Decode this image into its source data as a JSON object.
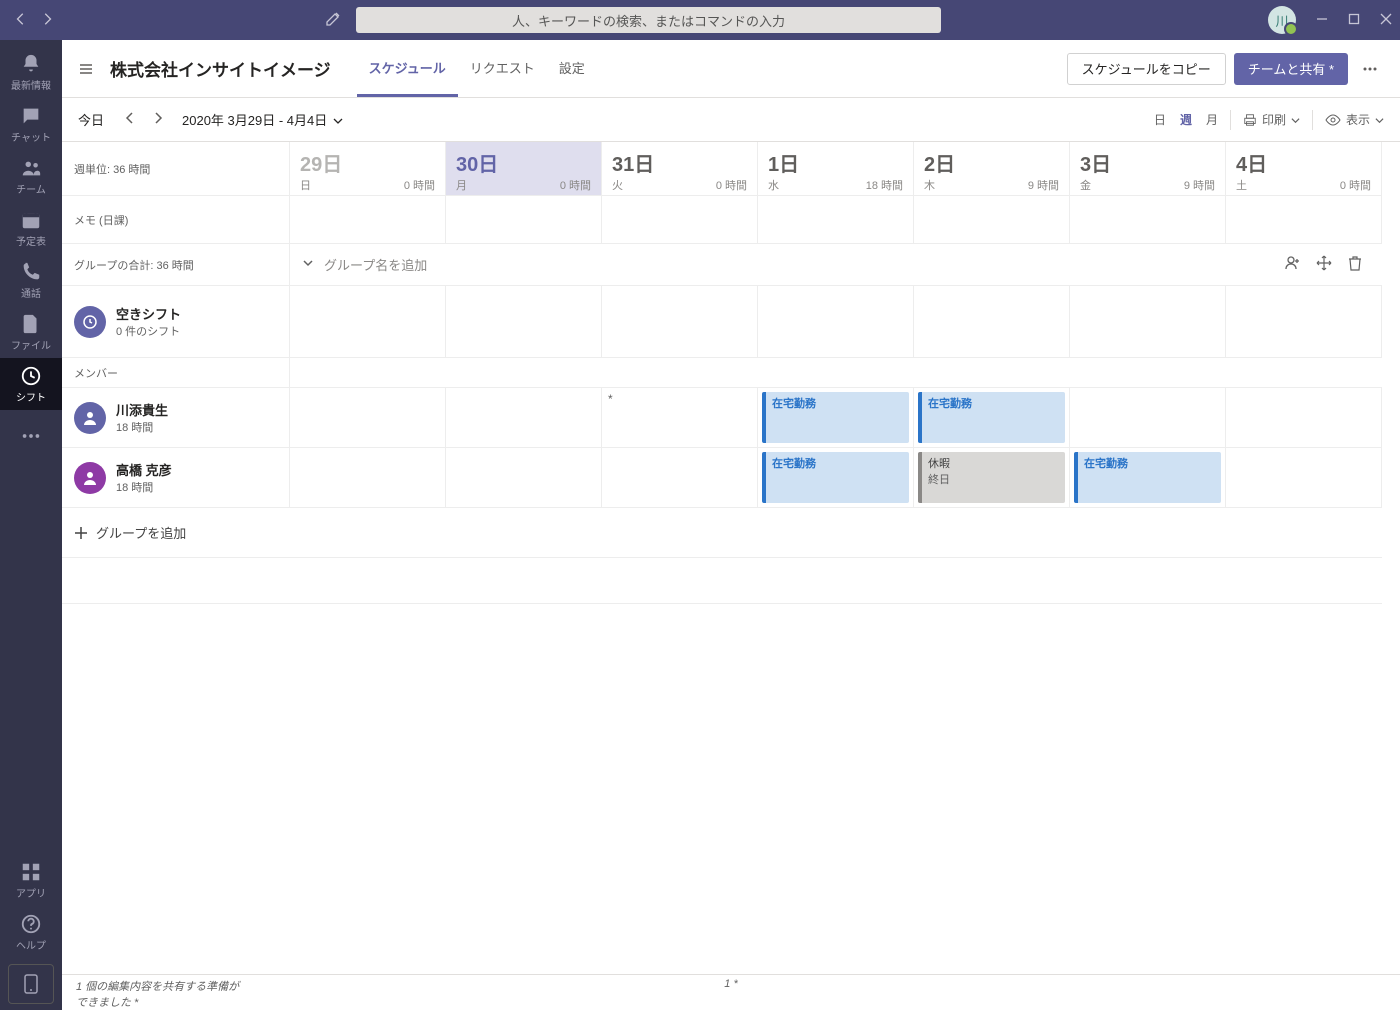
{
  "titlebar": {
    "search_placeholder": "人、キーワードの検索、またはコマンドの入力",
    "avatar_initial": "川"
  },
  "rail": {
    "items": [
      {
        "label": "最新情報"
      },
      {
        "label": "チャット"
      },
      {
        "label": "チーム"
      },
      {
        "label": "予定表"
      },
      {
        "label": "通話"
      },
      {
        "label": "ファイル"
      },
      {
        "label": "シフト"
      }
    ],
    "apps_label": "アプリ",
    "help_label": "ヘルプ"
  },
  "header": {
    "title": "株式会社インサイトイメージ",
    "tabs": [
      "スケジュール",
      "リクエスト",
      "設定"
    ],
    "copy_btn": "スケジュールをコピー",
    "share_btn": "チームと共有 *"
  },
  "toolbar": {
    "today": "今日",
    "range": "2020年 3月29日 - 4月4日",
    "seg_day": "日",
    "seg_week": "週",
    "seg_month": "月",
    "print": "印刷",
    "view": "表示"
  },
  "days": [
    {
      "num": "29日",
      "dow": "日",
      "hours": "0 時間",
      "cls": "past"
    },
    {
      "num": "30日",
      "dow": "月",
      "hours": "0 時間",
      "cls": "today"
    },
    {
      "num": "31日",
      "dow": "火",
      "hours": "0 時間",
      "cls": ""
    },
    {
      "num": "1日",
      "dow": "水",
      "hours": "18 時間",
      "cls": ""
    },
    {
      "num": "2日",
      "dow": "木",
      "hours": "9 時間",
      "cls": ""
    },
    {
      "num": "3日",
      "dow": "金",
      "hours": "9 時間",
      "cls": ""
    },
    {
      "num": "4日",
      "dow": "土",
      "hours": "0 時間",
      "cls": ""
    }
  ],
  "left": {
    "week_unit": "週単位: 36 時間",
    "memo": "メモ (日課)",
    "group_total": "グループの合計: 36 時間",
    "empty_shift_title": "空きシフト",
    "empty_shift_sub": "0 件のシフト",
    "members_label": "メンバー"
  },
  "group_header": {
    "placeholder": "グループ名を追加"
  },
  "members": [
    {
      "name": "川添貴生",
      "hours": "18 時間",
      "color": "#6264a7"
    },
    {
      "name": "高橋 克彦",
      "hours": "18 時間",
      "color": "#8e3aa5"
    }
  ],
  "shifts": {
    "wfh_label": "在宅勤務",
    "off_label": "休暇",
    "off_sub": "終日"
  },
  "add_group": "グループを追加",
  "status": {
    "left1": "1 個の編集内容を共有する準備が",
    "left2": "できました *",
    "center": "1 *"
  }
}
